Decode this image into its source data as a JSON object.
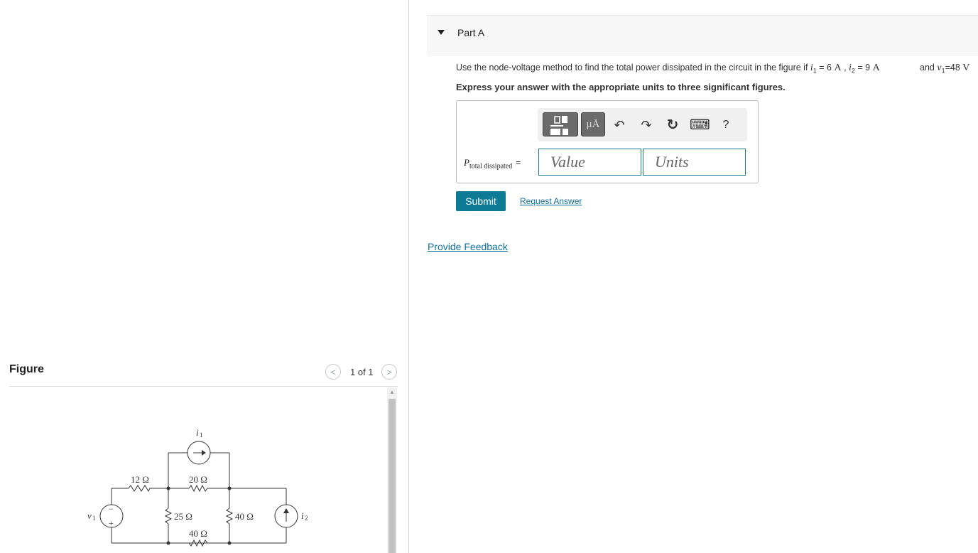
{
  "figure": {
    "header": "Figure",
    "pager": {
      "prev": "<",
      "count": "1 of 1",
      "next": ">"
    },
    "circuit_labels": {
      "i1": "i",
      "i1_sub": "1",
      "r1": "12 Ω",
      "r2": "20 Ω",
      "r3": "25 Ω",
      "r4": "40 Ω",
      "r5": "40 Ω",
      "v1": "v",
      "v1_sub": "1",
      "i2": "i",
      "i2_sub": "2",
      "plus": "+",
      "minus": "−"
    }
  },
  "part": {
    "title": "Part A",
    "question_prefix": "Use the node-voltage method to find the total power dissipated in the circuit in the figure if ",
    "i1_var": "i",
    "i1_sub": "1",
    "i1_value": " = 6 ",
    "i1_unit": "A",
    "sep": " , ",
    "i2_var": "i",
    "i2_sub": "2",
    "i2_value": " = 9 ",
    "i2_unit": "A",
    "and_text": "and ",
    "v1_var": "v",
    "v1_sub": "1",
    "v1_value": "=48 ",
    "v1_unit": "V",
    "instruction": "Express your answer with the appropriate units to three significant figures."
  },
  "answer": {
    "label_var": "P",
    "label_sub": "total dissipated",
    "equals": "=",
    "value_placeholder": "Value",
    "units_placeholder": "Units",
    "toolbar": {
      "units_btn": "μÅ",
      "undo": "↶",
      "redo": "↷",
      "reset": "↻",
      "keyboard": "⌨",
      "help": "?"
    }
  },
  "actions": {
    "submit": "Submit",
    "request_answer": "Request Answer",
    "provide_feedback": "Provide Feedback"
  }
}
